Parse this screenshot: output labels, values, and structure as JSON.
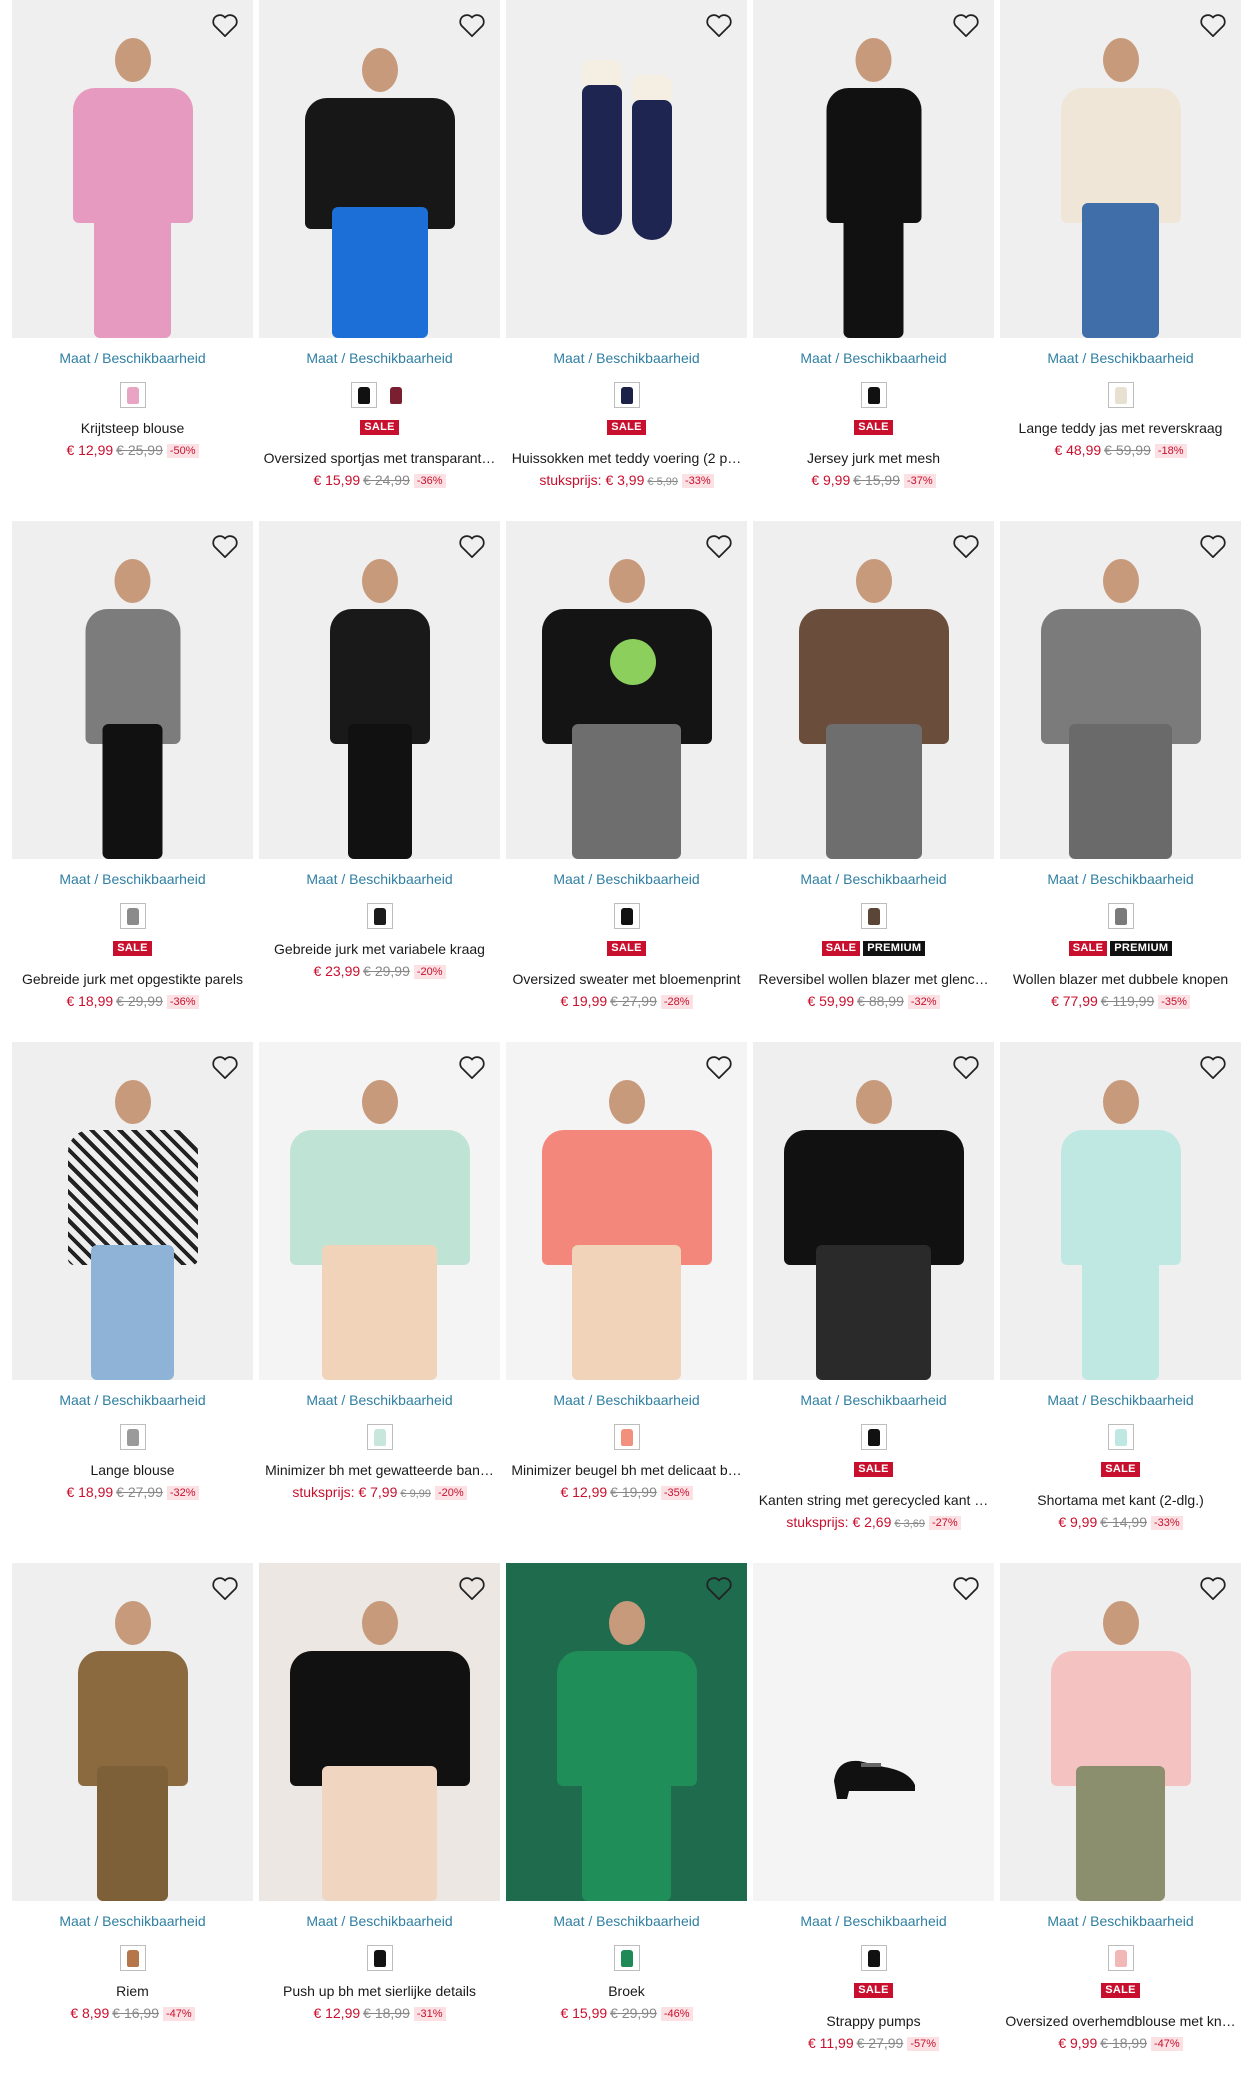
{
  "size_link": "Maat / Beschikbaarheid",
  "badges": {
    "sale": "SALE",
    "premium": "PREMIUM"
  },
  "icons": {
    "wishlist": "heart-outline-icon"
  },
  "colors": {
    "accent_link": "#2f7fa3",
    "sale_red": "#c8102e",
    "discount_bg": "#fbe1e3"
  },
  "products": [
    {
      "name": "Krijtsteep blouse",
      "prefix": "",
      "price": "€ 12,99",
      "old_price": "€ 25,99",
      "discount": "-50%",
      "sale": false,
      "premium": false,
      "swatches": [
        "#e9a4c4"
      ]
    },
    {
      "name": "Oversized sportjas met transparant…",
      "prefix": "",
      "price": "€ 15,99",
      "old_price": "€ 24,99",
      "discount": "-36%",
      "sale": true,
      "premium": false,
      "swatches": [
        "#111111",
        "#7a1f2f"
      ]
    },
    {
      "name": "Huissokken met teddy voering (2 p…",
      "prefix": "stuksprijs:",
      "price": "€ 3,99",
      "old_price": "€ 5,99",
      "discount": "-33%",
      "sale": true,
      "premium": false,
      "swatches": [
        "#1b2147"
      ]
    },
    {
      "name": "Jersey jurk met mesh",
      "prefix": "",
      "price": "€ 9,99",
      "old_price": "€ 15,99",
      "discount": "-37%",
      "sale": true,
      "premium": false,
      "swatches": [
        "#111111"
      ]
    },
    {
      "name": "Lange teddy jas met reverskraag",
      "prefix": "",
      "price": "€ 48,99",
      "old_price": "€ 59,99",
      "discount": "-18%",
      "sale": false,
      "premium": false,
      "swatches": [
        "#e8e1d2"
      ]
    },
    {
      "name": "Gebreide jurk met opgestikte parels",
      "prefix": "",
      "price": "€ 18,99",
      "old_price": "€ 29,99",
      "discount": "-36%",
      "sale": true,
      "premium": false,
      "swatches": [
        "#8b8b8b"
      ]
    },
    {
      "name": "Gebreide jurk met variabele kraag",
      "prefix": "",
      "price": "€ 23,99",
      "old_price": "€ 29,99",
      "discount": "-20%",
      "sale": false,
      "premium": false,
      "swatches": [
        "#1b1b1b"
      ]
    },
    {
      "name": "Oversized sweater met bloemenprint",
      "prefix": "",
      "price": "€ 19,99",
      "old_price": "€ 27,99",
      "discount": "-28%",
      "sale": true,
      "premium": false,
      "swatches": [
        "#111111"
      ]
    },
    {
      "name": "Reversibel wollen blazer met glenc…",
      "prefix": "",
      "price": "€ 59,99",
      "old_price": "€ 88,99",
      "discount": "-32%",
      "sale": true,
      "premium": true,
      "swatches": [
        "#5b4536"
      ]
    },
    {
      "name": "Wollen blazer met dubbele knopen",
      "prefix": "",
      "price": "€ 77,99",
      "old_price": "€ 119,99",
      "discount": "-35%",
      "sale": true,
      "premium": true,
      "swatches": [
        "#7a7a7a"
      ]
    },
    {
      "name": "Lange blouse",
      "prefix": "",
      "price": "€ 18,99",
      "old_price": "€ 27,99",
      "discount": "-32%",
      "sale": false,
      "premium": false,
      "swatches": [
        "#9a9a9a"
      ]
    },
    {
      "name": "Minimizer bh met gewatteerde ban…",
      "prefix": "stuksprijs:",
      "price": "€ 7,99",
      "old_price": "€ 9,99",
      "discount": "-20%",
      "sale": false,
      "premium": false,
      "swatches": [
        "#c9e6dc"
      ]
    },
    {
      "name": "Minimizer beugel bh met delicaat b…",
      "prefix": "",
      "price": "€ 12,99",
      "old_price": "€ 19,99",
      "discount": "-35%",
      "sale": false,
      "premium": false,
      "swatches": [
        "#f2907e"
      ]
    },
    {
      "name": "Kanten string met gerecycled kant …",
      "prefix": "stuksprijs:",
      "price": "€ 2,69",
      "old_price": "€ 3,69",
      "discount": "-27%",
      "sale": true,
      "premium": false,
      "swatches": [
        "#111111"
      ]
    },
    {
      "name": "Shortama met kant (2-dlg.)",
      "prefix": "",
      "price": "€ 9,99",
      "old_price": "€ 14,99",
      "discount": "-33%",
      "sale": true,
      "premium": false,
      "swatches": [
        "#bfe8e2"
      ]
    },
    {
      "name": "Riem",
      "prefix": "",
      "price": "€ 8,99",
      "old_price": "€ 16,99",
      "discount": "-47%",
      "sale": false,
      "premium": false,
      "swatches": [
        "#b5774a"
      ]
    },
    {
      "name": "Push up bh met sierlijke details",
      "prefix": "",
      "price": "€ 12,99",
      "old_price": "€ 18,99",
      "discount": "-31%",
      "sale": false,
      "premium": false,
      "swatches": [
        "#111111"
      ]
    },
    {
      "name": "Broek",
      "prefix": "",
      "price": "€ 15,99",
      "old_price": "€ 29,99",
      "discount": "-46%",
      "sale": false,
      "premium": false,
      "swatches": [
        "#1f8a55"
      ]
    },
    {
      "name": "Strappy pumps",
      "prefix": "",
      "price": "€ 11,99",
      "old_price": "€ 27,99",
      "discount": "-57%",
      "sale": true,
      "premium": false,
      "swatches": [
        "#111111"
      ]
    },
    {
      "name": "Oversized overhemdblouse met kn…",
      "prefix": "",
      "price": "€ 9,99",
      "old_price": "€ 18,99",
      "discount": "-47%",
      "sale": true,
      "premium": false,
      "swatches": [
        "#f2b8b8"
      ]
    }
  ]
}
